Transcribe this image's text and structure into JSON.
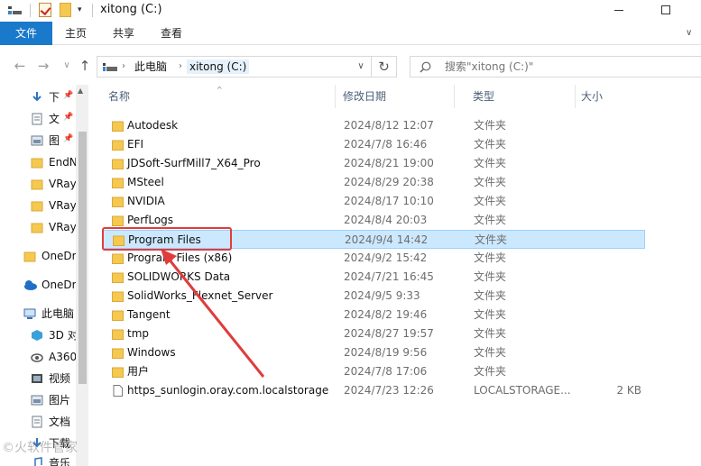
{
  "window": {
    "title": "xitong (C:)",
    "minimize_glyph": "—",
    "maximize_glyph": "☐",
    "quick_access_menu_glyph": "▾"
  },
  "ribbon": {
    "tabs": [
      {
        "label": "文件",
        "active": true
      },
      {
        "label": "主页"
      },
      {
        "label": "共享"
      },
      {
        "label": "查看"
      }
    ],
    "collapse_glyph": "∨"
  },
  "nav_buttons": {
    "back": "←",
    "forward": "→",
    "recent": "∨",
    "up": "↑"
  },
  "address": {
    "segments": [
      "此电脑",
      "xitong (C:)"
    ],
    "chevron": "›",
    "dropdown": "∨",
    "refresh": "↻"
  },
  "search": {
    "placeholder": "搜索\"xitong (C:)\""
  },
  "nav_pane": {
    "items": [
      {
        "label": "下",
        "icon": "download-icon",
        "pinned": true
      },
      {
        "label": "文",
        "icon": "document-icon",
        "pinned": true
      },
      {
        "label": "图",
        "icon": "picture-icon",
        "pinned": true
      },
      {
        "label": "EndN",
        "icon": "folder-icon"
      },
      {
        "label": "VRay",
        "icon": "folder-icon"
      },
      {
        "label": "VRay",
        "icon": "folder-icon"
      },
      {
        "label": "VRay",
        "icon": "folder-icon"
      },
      {
        "label": "OneDr",
        "icon": "folder-icon"
      },
      {
        "label": "OneDr",
        "icon": "cloud-icon"
      },
      {
        "label": "此电脑",
        "icon": "computer-icon"
      },
      {
        "label": "3D 对",
        "icon": "3d-objects-icon"
      },
      {
        "label": "A360",
        "icon": "a360-icon"
      },
      {
        "label": "视频",
        "icon": "video-icon"
      },
      {
        "label": "图片",
        "icon": "picture-icon"
      },
      {
        "label": "文档",
        "icon": "document-icon"
      },
      {
        "label": "下载",
        "icon": "download-icon"
      },
      {
        "label": "音乐",
        "icon": "music-icon"
      }
    ],
    "pin_glyph": "📌"
  },
  "columns": [
    {
      "label": "名称"
    },
    {
      "label": "修改日期"
    },
    {
      "label": "类型"
    },
    {
      "label": "大小"
    }
  ],
  "sort_glyph": "^",
  "files": [
    {
      "name": "Autodesk",
      "date": "2024/8/12 12:07",
      "type": "文件夹",
      "size": "",
      "icon": "folder-icon"
    },
    {
      "name": "EFI",
      "date": "2024/7/8 16:46",
      "type": "文件夹",
      "size": "",
      "icon": "folder-icon"
    },
    {
      "name": "JDSoft-SurfMill7_X64_Pro",
      "date": "2024/8/21 19:00",
      "type": "文件夹",
      "size": "",
      "icon": "folder-icon"
    },
    {
      "name": "MSteel",
      "date": "2024/8/29 20:38",
      "type": "文件夹",
      "size": "",
      "icon": "folder-icon"
    },
    {
      "name": "NVIDIA",
      "date": "2024/8/17 10:10",
      "type": "文件夹",
      "size": "",
      "icon": "folder-icon"
    },
    {
      "name": "PerfLogs",
      "date": "2024/8/4 20:03",
      "type": "文件夹",
      "size": "",
      "icon": "folder-icon"
    },
    {
      "name": "Program Files",
      "date": "2024/9/4 14:42",
      "type": "文件夹",
      "size": "",
      "icon": "folder-icon",
      "selected": true
    },
    {
      "name": "Program Files (x86)",
      "date": "2024/9/2 15:42",
      "type": "文件夹",
      "size": "",
      "icon": "folder-icon"
    },
    {
      "name": "SOLIDWORKS Data",
      "date": "2024/7/21 16:45",
      "type": "文件夹",
      "size": "",
      "icon": "folder-icon"
    },
    {
      "name": "SolidWorks_Flexnet_Server",
      "date": "2024/9/5 9:33",
      "type": "文件夹",
      "size": "",
      "icon": "folder-icon"
    },
    {
      "name": "Tangent",
      "date": "2024/8/2 19:46",
      "type": "文件夹",
      "size": "",
      "icon": "folder-icon"
    },
    {
      "name": "tmp",
      "date": "2024/8/27 19:57",
      "type": "文件夹",
      "size": "",
      "icon": "folder-icon"
    },
    {
      "name": "Windows",
      "date": "2024/8/19 9:56",
      "type": "文件夹",
      "size": "",
      "icon": "folder-icon"
    },
    {
      "name": "用户",
      "date": "2024/7/8 17:06",
      "type": "文件夹",
      "size": "",
      "icon": "folder-icon"
    },
    {
      "name": "https_sunlogin.oray.com.localstorage",
      "date": "2024/7/23 12:26",
      "type": "LOCALSTORAGE...",
      "size": "2 KB",
      "icon": "file-icon"
    }
  ],
  "annotation": {
    "highlight_color": "#e03c3c",
    "watermark": "©火软件管家"
  },
  "colors": {
    "accent": "#1979ca",
    "selection_bg": "#cce8ff",
    "selection_border": "#99d1ff",
    "folder": "#f5c94f"
  }
}
